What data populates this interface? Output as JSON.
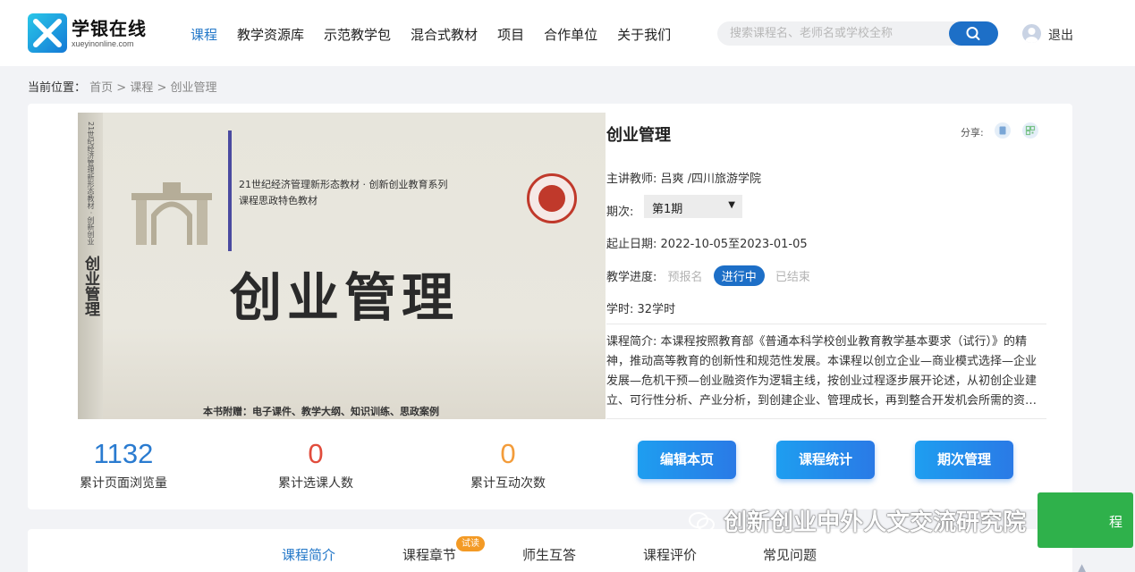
{
  "header": {
    "logo_text": "学银在线",
    "logo_sub": "xueyinonline.com",
    "nav": [
      "课程",
      "教学资源库",
      "示范教学包",
      "混合式教材",
      "项目",
      "合作单位",
      "关于我们"
    ],
    "search_placeholder": "搜索课程名、老师名或学校全称",
    "logout": "退出"
  },
  "breadcrumb": {
    "prefix": "当前位置：",
    "items": [
      "首页",
      "课程",
      "创业管理"
    ],
    "separator": " > "
  },
  "cover": {
    "series": "21世纪经济管理新形态教材 · 创新创业教育系列",
    "series2": "课程思政特色教材",
    "title": "创业管理",
    "attachment": "本书附赠：电子课件、教学大纲、知识训练、思政案例"
  },
  "stats": [
    {
      "value": "1132",
      "label": "累计页面浏览量"
    },
    {
      "value": "0",
      "label": "累计选课人数"
    },
    {
      "value": "0",
      "label": "累计互动次数"
    }
  ],
  "course": {
    "title": "创业管理",
    "share_label": "分享:",
    "teacher_label": "主讲教师:",
    "teacher": "吕爽 /四川旅游学院",
    "period_label": "期次:",
    "period_value": "第1期",
    "date_label": "起止日期:",
    "date_range": "2022-10-05至2023-01-05",
    "progress_label": "教学进度:",
    "progress_states": [
      "预报名",
      "进行中",
      "已结束"
    ],
    "hours_label": "学时:",
    "hours": "32学时",
    "desc_label": "课程简介:",
    "desc": "本课程按照教育部《普通本科学校创业教育教学基本要求（试行）》的精神，推动高等教育的创新性和规范性发展。本课程以创立企业—商业模式选择—企业发展—危机干预—创业融资作为逻辑主线，按创业过程逐步展开论述，从初创企业建立、可行性分析、产业分析，到创建企业、管理成长，再到整合开发机会所需的资源（创业团队、创业资金等）"
  },
  "actions": {
    "edit": "编辑本页",
    "stats": "课程统计",
    "period_manage": "期次管理"
  },
  "tabs": {
    "items": [
      "课程简介",
      "课程章节",
      "师生互答",
      "课程评价",
      "常见问题"
    ],
    "trial_badge": "试读"
  },
  "overlay": {
    "watermark": "创新创业中外人文交流研究院",
    "green_button": "程"
  },
  "colors": {
    "primary": "#1d6fc7",
    "accent_blue": "#2a7bd0",
    "red": "#e14c3c",
    "orange": "#f39c3a",
    "green": "#2fb14b"
  }
}
